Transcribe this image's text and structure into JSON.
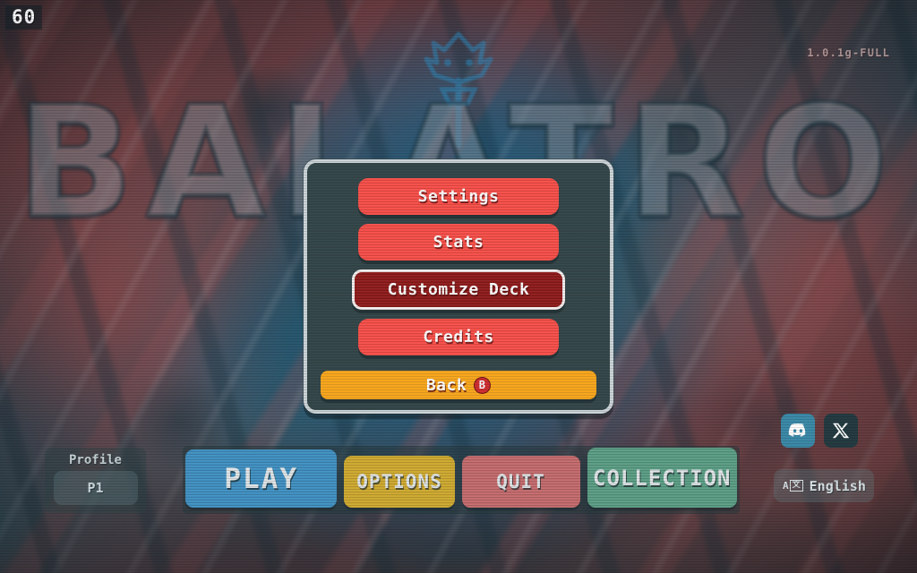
{
  "hud": {
    "fps": "60",
    "version": "1.0.1g-FULL"
  },
  "background": {
    "logo_text": "BALATRO",
    "logo_icon": "joker-silhouette"
  },
  "menu_panel": {
    "items": [
      {
        "label": "Settings",
        "state": "normal",
        "color": "#f64e48"
      },
      {
        "label": "Stats",
        "state": "normal",
        "color": "#f64e48"
      },
      {
        "label": "Customize Deck",
        "state": "selected",
        "color": "#8e1b1b"
      },
      {
        "label": "Credits",
        "state": "normal",
        "color": "#f64e48"
      }
    ],
    "back": {
      "label": "Back",
      "badge": "B",
      "color": "#f8a61c",
      "badge_color": "#cf2f32"
    }
  },
  "bottom_nav": [
    {
      "label": "PLAY",
      "color": "#3f8fc0"
    },
    {
      "label": "OPTIONS",
      "color": "#cda82f"
    },
    {
      "label": "QUIT",
      "color": "#c26a6c"
    },
    {
      "label": "COLLECTION",
      "color": "#5a9c84"
    }
  ],
  "profile": {
    "label": "Profile",
    "value": "P1"
  },
  "socials": [
    {
      "name": "discord",
      "color": "#3c8aa8"
    },
    {
      "name": "x",
      "color": "#253c42"
    }
  ],
  "language": {
    "icon": "translate-icon",
    "icon_letter": "A",
    "icon_boxed_letter": "文",
    "label": "English"
  }
}
